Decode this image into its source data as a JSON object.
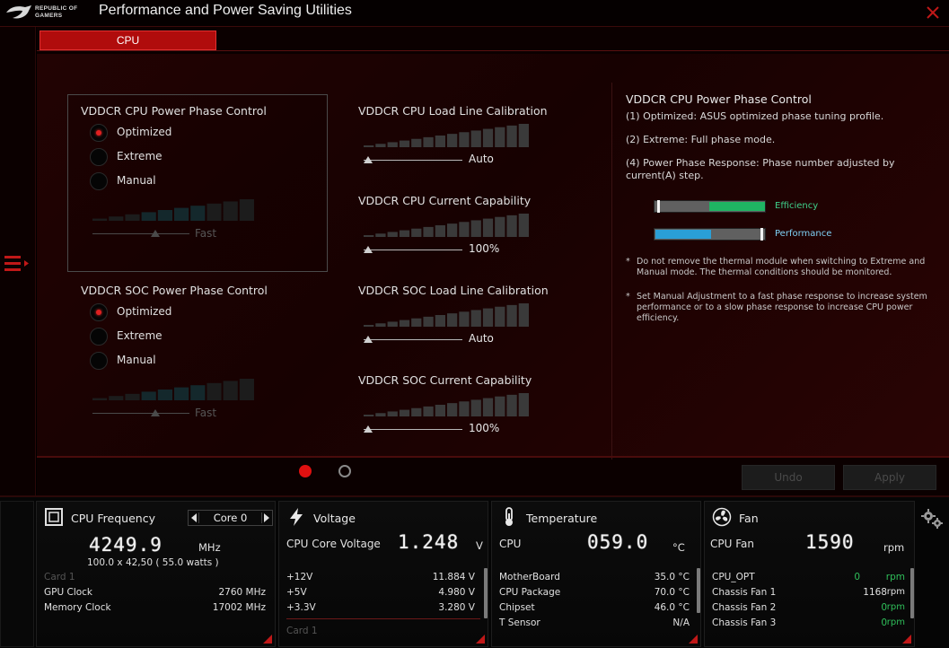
{
  "app": {
    "title": "Performance and Power Saving Utilities",
    "logo_line1": "REPUBLIC OF",
    "logo_line2": "GAMERS"
  },
  "tabs": [
    {
      "label": "CPU",
      "active": true
    }
  ],
  "cpu_phase": {
    "title": "VDDCR CPU Power Phase Control",
    "options": [
      {
        "label": "Optimized",
        "selected": true
      },
      {
        "label": "Extreme",
        "selected": false
      },
      {
        "label": "Manual",
        "selected": false
      }
    ],
    "slider_value": "Fast"
  },
  "soc_phase": {
    "title": "VDDCR SOC Power Phase Control",
    "options": [
      {
        "label": "Optimized",
        "selected": true
      },
      {
        "label": "Extreme",
        "selected": false
      },
      {
        "label": "Manual",
        "selected": false
      }
    ],
    "slider_value": "Fast"
  },
  "sliders": [
    {
      "title": "VDDCR CPU Load Line Calibration",
      "value": "Auto"
    },
    {
      "title": "VDDCR CPU Current Capability",
      "value": "100%"
    },
    {
      "title": "VDDCR SOC Load Line Calibration",
      "value": "Auto"
    },
    {
      "title": "VDDCR SOC Current Capability",
      "value": "100%"
    }
  ],
  "help": {
    "title": "VDDCR CPU Power Phase Control",
    "line1": "(1) Optimized: ASUS optimized phase tuning profile.",
    "line2": "(2) Extreme: Full phase mode.",
    "line3": "(4) Power Phase Response: Phase number adjusted by current(A) step.",
    "bars": [
      {
        "label": "Efficiency",
        "color": "#1fb463",
        "level": 0.5
      },
      {
        "label": "Performance",
        "color": "#2a9fd6",
        "level": 0.5
      }
    ],
    "note1": "Do not remove the thermal module when switching to Extreme and Manual mode. The thermal conditions should be monitored.",
    "note2": "Set Manual Adjustment to a fast phase response to increase system performance or to a slow phase response to increase CPU power efficiency."
  },
  "pager": {
    "pages": 2,
    "current": 1
  },
  "buttons": {
    "undo": "Undo",
    "apply": "Apply"
  },
  "monitor": {
    "cpu": {
      "title": "CPU Frequency",
      "core": "Core 0",
      "freq": "4249.9",
      "freq_unit": "MHz",
      "detail": "100.0  x  42,50 ( 55.0    watts )",
      "card": "Card 1",
      "rows": [
        {
          "label": "GPU Clock",
          "value": "2760 MHz"
        },
        {
          "label": "Memory Clock",
          "value": "17002 MHz"
        }
      ]
    },
    "voltage": {
      "title": "Voltage",
      "main_label": "CPU Core Voltage",
      "main_value": "1.248",
      "main_unit": "V",
      "rows": [
        {
          "label": "+12V",
          "value": "11.884  V"
        },
        {
          "label": "+5V",
          "value": "4.980  V"
        },
        {
          "label": "+3.3V",
          "value": "3.280  V"
        }
      ],
      "next": "Card 1"
    },
    "temperature": {
      "title": "Temperature",
      "main_label": "CPU",
      "main_value": "059.0",
      "main_unit": "°C",
      "rows": [
        {
          "label": "MotherBoard",
          "value": "35.0 °C"
        },
        {
          "label": "CPU Package",
          "value": "70.0 °C"
        },
        {
          "label": "Chipset",
          "value": "46.0 °C"
        },
        {
          "label": "T Sensor",
          "value": "N/A"
        }
      ]
    },
    "fan": {
      "title": "Fan",
      "main_label": "CPU Fan",
      "main_value": "1590",
      "main_unit": "rpm",
      "rows": [
        {
          "label": "CPU_OPT",
          "value": "0",
          "unit": "rpm"
        },
        {
          "label": "Chassis Fan 1",
          "value": "1168",
          "unit": "rpm"
        },
        {
          "label": "Chassis Fan 2",
          "value": "0",
          "unit": "rpm"
        },
        {
          "label": "Chassis Fan 3",
          "value": "0",
          "unit": "rpm"
        }
      ]
    }
  }
}
